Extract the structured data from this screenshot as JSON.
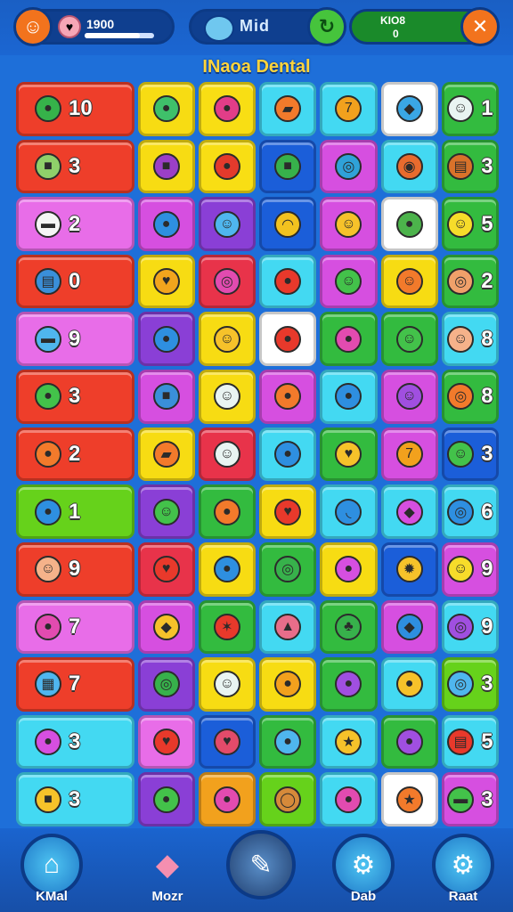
{
  "header": {
    "score": "1900",
    "player_name": "Mid",
    "coins_label": "KIO8",
    "coins_value": "0",
    "score_progress_pct": 80
  },
  "level_title": "INaoa Dental",
  "board": {
    "rows": 13,
    "cols": 8,
    "tiles": [
      {
        "row": 0,
        "col": 0,
        "span": 2,
        "color": "#ee3e2a",
        "icon": "green-bean-icon",
        "glyph": "●",
        "icon_color": "#36b24a",
        "count": "10"
      },
      {
        "row": 0,
        "col": 2,
        "color": "#f7dc13",
        "icon": "green-blob-icon",
        "glyph": "●",
        "icon_color": "#3fc06a",
        "count": ""
      },
      {
        "row": 0,
        "col": 3,
        "color": "#f8de14",
        "icon": "berry-icon",
        "glyph": "●",
        "icon_color": "#e23d88",
        "count": ""
      },
      {
        "row": 0,
        "col": 4,
        "color": "#43d9f2",
        "icon": "carrot-icon",
        "glyph": "▰",
        "icon_color": "#f27a2b",
        "count": ""
      },
      {
        "row": 0,
        "col": 5,
        "color": "#43d9f2",
        "icon": "seven-icon",
        "glyph": "7",
        "icon_color": "#f2a11d",
        "count": ""
      },
      {
        "row": 0,
        "col": 6,
        "color": "#ffffff",
        "icon": "blue-fish-icon",
        "glyph": "◆",
        "icon_color": "#3aa7e5",
        "count": ""
      },
      {
        "row": 0,
        "col": 7,
        "color": "#33bb3f",
        "icon": "ghost-face-icon",
        "glyph": "☺",
        "icon_color": "#e9f4f2",
        "count": "1"
      },
      {
        "row": 1,
        "col": 0,
        "span": 2,
        "color": "#ee3e2a",
        "icon": "chest-icon",
        "glyph": "■",
        "icon_color": "#8fd06a",
        "count": "3"
      },
      {
        "row": 1,
        "col": 2,
        "color": "#f7dc13",
        "icon": "purple-box-icon",
        "glyph": "■",
        "icon_color": "#9b3fc7",
        "count": ""
      },
      {
        "row": 1,
        "col": 3,
        "color": "#f8de14",
        "icon": "apple-icon",
        "glyph": "●",
        "icon_color": "#e33a2c",
        "count": ""
      },
      {
        "row": 1,
        "col": 4,
        "color": "#1b5ed9",
        "icon": "green-book-icon",
        "glyph": "■",
        "icon_color": "#37b14b",
        "count": ""
      },
      {
        "row": 1,
        "col": 5,
        "color": "#d64fe0",
        "icon": "donut-icon",
        "glyph": "◎",
        "icon_color": "#2fa2d8",
        "count": ""
      },
      {
        "row": 1,
        "col": 6,
        "color": "#43d9f2",
        "icon": "snail-icon",
        "glyph": "◉",
        "icon_color": "#e86b2e",
        "count": ""
      },
      {
        "row": 1,
        "col": 7,
        "color": "#33bb3f",
        "icon": "drum-icon",
        "glyph": "▤",
        "icon_color": "#d9722a",
        "count": "3"
      },
      {
        "row": 2,
        "col": 0,
        "span": 2,
        "color": "#e86de8",
        "icon": "bus-icon",
        "glyph": "▬",
        "icon_color": "#f5f5f5",
        "count": "2"
      },
      {
        "row": 2,
        "col": 2,
        "color": "#d64fe0",
        "icon": "blue-leaf-icon",
        "glyph": "●",
        "icon_color": "#2e8fe0",
        "count": ""
      },
      {
        "row": 2,
        "col": 3,
        "color": "#8a3fd6",
        "icon": "blue-blob-icon",
        "glyph": "☺",
        "icon_color": "#4fb6ee",
        "count": ""
      },
      {
        "row": 2,
        "col": 4,
        "color": "#1b5ed9",
        "icon": "rainbow-icon",
        "glyph": "◠",
        "icon_color": "#f2c21f",
        "count": ""
      },
      {
        "row": 2,
        "col": 5,
        "color": "#d64fe0",
        "icon": "smiley-coin-icon",
        "glyph": "☺",
        "icon_color": "#f6c22a",
        "count": ""
      },
      {
        "row": 2,
        "col": 6,
        "color": "#ffffff",
        "icon": "leaf-icon",
        "glyph": "●",
        "icon_color": "#4cb34b",
        "count": ""
      },
      {
        "row": 2,
        "col": 7,
        "color": "#33bb3f",
        "icon": "yellow-smile-icon",
        "glyph": "☺",
        "icon_color": "#f6dc2a",
        "count": "5"
      },
      {
        "row": 3,
        "col": 0,
        "span": 2,
        "color": "#ee3e2a",
        "icon": "barrel-icon",
        "glyph": "▤",
        "icon_color": "#3a8fd9",
        "count": "0"
      },
      {
        "row": 3,
        "col": 2,
        "color": "#f7dc13",
        "icon": "heart-icon",
        "glyph": "♥",
        "icon_color": "#f2a51d",
        "count": ""
      },
      {
        "row": 3,
        "col": 3,
        "color": "#e8334a",
        "icon": "lollipop-icon",
        "glyph": "◎",
        "icon_color": "#e24bb0",
        "count": ""
      },
      {
        "row": 3,
        "col": 4,
        "color": "#43d9f2",
        "icon": "tomato-icon",
        "glyph": "●",
        "icon_color": "#e8392b",
        "count": ""
      },
      {
        "row": 3,
        "col": 5,
        "color": "#d64fe0",
        "icon": "green-ball-icon",
        "glyph": "☺",
        "icon_color": "#43c24a",
        "count": ""
      },
      {
        "row": 3,
        "col": 6,
        "color": "#f7dc13",
        "icon": "orange-face-icon",
        "glyph": "☺",
        "icon_color": "#f27a2b",
        "count": ""
      },
      {
        "row": 3,
        "col": 7,
        "color": "#33bb3f",
        "icon": "magnifier-icon",
        "glyph": "◎",
        "icon_color": "#f0a06a",
        "count": "2"
      },
      {
        "row": 4,
        "col": 0,
        "span": 2,
        "color": "#e86de8",
        "icon": "pot-icon",
        "glyph": "▬",
        "icon_color": "#4fb6ee",
        "count": "9"
      },
      {
        "row": 4,
        "col": 2,
        "color": "#8a3fd6",
        "icon": "bird-icon",
        "glyph": "●",
        "icon_color": "#2e8fe0",
        "count": ""
      },
      {
        "row": 4,
        "col": 3,
        "color": "#f7dc13",
        "icon": "cookie-face-icon",
        "glyph": "☺",
        "icon_color": "#f6c22a",
        "count": ""
      },
      {
        "row": 4,
        "col": 4,
        "color": "#ffffff",
        "icon": "red-apple-icon",
        "glyph": "●",
        "icon_color": "#e8392b",
        "count": ""
      },
      {
        "row": 4,
        "col": 5,
        "color": "#33bb3f",
        "icon": "plum-icon",
        "glyph": "●",
        "icon_color": "#e24bb0",
        "count": ""
      },
      {
        "row": 4,
        "col": 6,
        "color": "#33bb3f",
        "icon": "frog-face-icon",
        "glyph": "☺",
        "icon_color": "#43c24a",
        "count": ""
      },
      {
        "row": 4,
        "col": 7,
        "color": "#43d9f2",
        "icon": "peach-face-icon",
        "glyph": "☺",
        "icon_color": "#f5b28a",
        "count": "8"
      },
      {
        "row": 5,
        "col": 0,
        "span": 2,
        "color": "#ee3e2a",
        "icon": "snake-icon",
        "glyph": "●",
        "icon_color": "#43c24a",
        "count": "3"
      },
      {
        "row": 5,
        "col": 2,
        "color": "#d64fe0",
        "icon": "notebook-icon",
        "glyph": "■",
        "icon_color": "#3a8fd9",
        "count": ""
      },
      {
        "row": 5,
        "col": 3,
        "color": "#f7dc13",
        "icon": "cloud-face-icon",
        "glyph": "☺",
        "icon_color": "#e9f4f2",
        "count": ""
      },
      {
        "row": 5,
        "col": 4,
        "color": "#d64fe0",
        "icon": "map-pin-icon",
        "glyph": "●",
        "icon_color": "#f27a2b",
        "count": ""
      },
      {
        "row": 5,
        "col": 5,
        "color": "#43d9f2",
        "icon": "blue-bell-icon",
        "glyph": "●",
        "icon_color": "#2e8fe0",
        "count": ""
      },
      {
        "row": 5,
        "col": 6,
        "color": "#d64fe0",
        "icon": "purple-monster-icon",
        "glyph": "☺",
        "icon_color": "#a04fe0",
        "count": ""
      },
      {
        "row": 5,
        "col": 7,
        "color": "#33bb3f",
        "icon": "spiral-icon",
        "glyph": "◎",
        "icon_color": "#f27a2b",
        "count": "8"
      },
      {
        "row": 6,
        "col": 0,
        "span": 2,
        "color": "#ee3e2a",
        "icon": "mushroom-icon",
        "glyph": "●",
        "icon_color": "#f27a2b",
        "count": "2"
      },
      {
        "row": 6,
        "col": 2,
        "color": "#f7dc13",
        "icon": "orange-stick-icon",
        "glyph": "▰",
        "icon_color": "#f27a2b",
        "count": ""
      },
      {
        "row": 6,
        "col": 3,
        "color": "#e8334a",
        "icon": "star-ghost-icon",
        "glyph": "☺",
        "icon_color": "#e9f4f2",
        "count": ""
      },
      {
        "row": 6,
        "col": 4,
        "color": "#43d9f2",
        "icon": "chat-bubble-icon",
        "glyph": "●",
        "icon_color": "#2e8fe0",
        "count": ""
      },
      {
        "row": 6,
        "col": 5,
        "color": "#33bb3f",
        "icon": "yellow-heart-icon",
        "glyph": "♥",
        "icon_color": "#f6c22a",
        "count": ""
      },
      {
        "row": 6,
        "col": 6,
        "color": "#d64fe0",
        "icon": "orange-seven-icon",
        "glyph": "7",
        "icon_color": "#f2a11d",
        "count": ""
      },
      {
        "row": 6,
        "col": 7,
        "color": "#1b5ed9",
        "icon": "green-blob-face-icon",
        "glyph": "☺",
        "icon_color": "#43c24a",
        "count": "3"
      },
      {
        "row": 7,
        "col": 0,
        "span": 2,
        "color": "#66d21b",
        "icon": "fish-tail-icon",
        "glyph": "●",
        "icon_color": "#2e8fe0",
        "count": "1"
      },
      {
        "row": 7,
        "col": 2,
        "color": "#8a3fd6",
        "icon": "green-monster-icon",
        "glyph": "☺",
        "icon_color": "#43c24a",
        "count": ""
      },
      {
        "row": 7,
        "col": 3,
        "color": "#33bb3f",
        "icon": "carrot-face-icon",
        "glyph": "●",
        "icon_color": "#f27a2b",
        "count": ""
      },
      {
        "row": 7,
        "col": 4,
        "color": "#f7dc13",
        "icon": "red-heart-icon",
        "glyph": "♥",
        "icon_color": "#e8392b",
        "count": ""
      },
      {
        "row": 7,
        "col": 5,
        "color": "#43d9f2",
        "icon": "banana-icon",
        "glyph": "◟",
        "icon_color": "#2e8fe0",
        "count": ""
      },
      {
        "row": 7,
        "col": 6,
        "color": "#43d9f2",
        "icon": "magenta-flag-icon",
        "glyph": "◆",
        "icon_color": "#d64fe0",
        "count": ""
      },
      {
        "row": 7,
        "col": 7,
        "color": "#43d9f2",
        "icon": "clock-icon",
        "glyph": "◎",
        "icon_color": "#2e8fe0",
        "count": "6"
      },
      {
        "row": 8,
        "col": 0,
        "span": 2,
        "color": "#ee3e2a",
        "icon": "baby-face-icon",
        "glyph": "☺",
        "icon_color": "#f5b28a",
        "count": "9"
      },
      {
        "row": 8,
        "col": 2,
        "color": "#e8334a",
        "icon": "apple-heart-icon",
        "glyph": "♥",
        "icon_color": "#e8392b",
        "count": ""
      },
      {
        "row": 8,
        "col": 3,
        "color": "#f7dc13",
        "icon": "blue-bomb-icon",
        "glyph": "●",
        "icon_color": "#2e8fe0",
        "count": ""
      },
      {
        "row": 8,
        "col": 4,
        "color": "#33bb3f",
        "icon": "square-spiral-icon",
        "glyph": "◎",
        "icon_color": "#37b14b",
        "count": ""
      },
      {
        "row": 8,
        "col": 5,
        "color": "#f7dc13",
        "icon": "purple-dome-icon",
        "glyph": "●",
        "icon_color": "#d64fe0",
        "count": ""
      },
      {
        "row": 8,
        "col": 6,
        "color": "#1b5ed9",
        "icon": "sun-icon",
        "glyph": "✹",
        "icon_color": "#f6c22a",
        "count": ""
      },
      {
        "row": 8,
        "col": 7,
        "color": "#d64fe0",
        "icon": "sun-face-icon",
        "glyph": "☺",
        "icon_color": "#f6dc2a",
        "count": "9"
      },
      {
        "row": 9,
        "col": 0,
        "span": 2,
        "color": "#e86de8",
        "icon": "lips-icon",
        "glyph": "●",
        "icon_color": "#e24bb0",
        "count": "7"
      },
      {
        "row": 9,
        "col": 2,
        "color": "#d64fe0",
        "icon": "cheese-icon",
        "glyph": "◆",
        "icon_color": "#f6c22a",
        "count": ""
      },
      {
        "row": 9,
        "col": 3,
        "color": "#33bb3f",
        "icon": "red-star-icon",
        "glyph": "✶",
        "icon_color": "#e8392b",
        "count": ""
      },
      {
        "row": 9,
        "col": 4,
        "color": "#43d9f2",
        "icon": "cupcake-icon",
        "glyph": "▲",
        "icon_color": "#e86d8a",
        "count": ""
      },
      {
        "row": 9,
        "col": 5,
        "color": "#33bb3f",
        "icon": "clover-icon",
        "glyph": "♣",
        "icon_color": "#37b14b",
        "count": ""
      },
      {
        "row": 9,
        "col": 6,
        "color": "#d64fe0",
        "icon": "gem-icon",
        "glyph": "◆",
        "icon_color": "#2e8fe0",
        "count": ""
      },
      {
        "row": 9,
        "col": 7,
        "color": "#43d9f2",
        "icon": "purple-donut-icon",
        "glyph": "◎",
        "icon_color": "#a04fe0",
        "count": "9"
      },
      {
        "row": 10,
        "col": 0,
        "span": 2,
        "color": "#ee3e2a",
        "icon": "window-icon",
        "glyph": "▦",
        "icon_color": "#4fb6ee",
        "count": "7"
      },
      {
        "row": 10,
        "col": 2,
        "color": "#8a3fd6",
        "icon": "green-swirl-icon",
        "glyph": "◎",
        "icon_color": "#37b14b",
        "count": ""
      },
      {
        "row": 10,
        "col": 3,
        "color": "#f7dc13",
        "icon": "white-cat-icon",
        "glyph": "☺",
        "icon_color": "#e9f4f2",
        "count": ""
      },
      {
        "row": 10,
        "col": 4,
        "color": "#f7dc13",
        "icon": "orange-egg-icon",
        "glyph": "●",
        "icon_color": "#f2a11d",
        "count": ""
      },
      {
        "row": 10,
        "col": 5,
        "color": "#33bb3f",
        "icon": "purple-shell-icon",
        "glyph": "●",
        "icon_color": "#a04fe0",
        "count": ""
      },
      {
        "row": 10,
        "col": 6,
        "color": "#43d9f2",
        "icon": "yellow-bird-icon",
        "glyph": "●",
        "icon_color": "#f6c22a",
        "count": ""
      },
      {
        "row": 10,
        "col": 7,
        "color": "#66d21b",
        "icon": "blue-ring-icon",
        "glyph": "◎",
        "icon_color": "#4fb6ee",
        "count": "3"
      },
      {
        "row": 11,
        "col": 0,
        "span": 2,
        "color": "#43d9f2",
        "icon": "purple-plum-icon",
        "glyph": "●",
        "icon_color": "#d64fe0",
        "count": "3"
      },
      {
        "row": 11,
        "col": 2,
        "color": "#e86de8",
        "icon": "big-heart-icon",
        "glyph": "♥",
        "icon_color": "#e8392b",
        "count": ""
      },
      {
        "row": 11,
        "col": 3,
        "color": "#1b5ed9",
        "icon": "cherry-heart-icon",
        "glyph": "♥",
        "icon_color": "#e24b6a",
        "count": ""
      },
      {
        "row": 11,
        "col": 4,
        "color": "#33bb3f",
        "icon": "blue-drop-icon",
        "glyph": "●",
        "icon_color": "#4fb6ee",
        "count": ""
      },
      {
        "row": 11,
        "col": 5,
        "color": "#43d9f2",
        "icon": "gold-star-icon",
        "glyph": "★",
        "icon_color": "#f6c22a",
        "count": ""
      },
      {
        "row": 11,
        "col": 6,
        "color": "#33bb3f",
        "icon": "purple-eye-icon",
        "glyph": "●",
        "icon_color": "#a04fe0",
        "count": ""
      },
      {
        "row": 11,
        "col": 7,
        "color": "#43d9f2",
        "icon": "cake-icon",
        "glyph": "▤",
        "icon_color": "#e8392b",
        "count": "5"
      },
      {
        "row": 12,
        "col": 0,
        "span": 2,
        "color": "#43d9f2",
        "icon": "jar-icon",
        "glyph": "■",
        "icon_color": "#f6c22a",
        "count": "3"
      },
      {
        "row": 12,
        "col": 2,
        "color": "#8a3fd6",
        "icon": "green-pepper-icon",
        "glyph": "●",
        "icon_color": "#43c24a",
        "count": ""
      },
      {
        "row": 12,
        "col": 3,
        "color": "#f2a11d",
        "icon": "pink-plum-icon",
        "glyph": "●",
        "icon_color": "#e24bb0",
        "count": ""
      },
      {
        "row": 12,
        "col": 4,
        "color": "#66d21b",
        "icon": "ring-icon",
        "glyph": "◯",
        "icon_color": "#d68a3a",
        "count": ""
      },
      {
        "row": 12,
        "col": 5,
        "color": "#43d9f2",
        "icon": "pink-apple-icon",
        "glyph": "●",
        "icon_color": "#e24bb0",
        "count": ""
      },
      {
        "row": 12,
        "col": 6,
        "color": "#ffffff",
        "icon": "orange-star-icon",
        "glyph": "★",
        "icon_color": "#f27a2b",
        "count": ""
      },
      {
        "row": 12,
        "col": 7,
        "color": "#d64fe0",
        "icon": "salad-bowl-icon",
        "glyph": "▬",
        "icon_color": "#43c24a",
        "count": "3"
      }
    ]
  },
  "bottom_nav": [
    {
      "label": "KMal",
      "icon": "home-icon",
      "glyph": "⌂",
      "name": "nav-home"
    },
    {
      "label": "Mozr",
      "icon": "eraser-icon",
      "glyph": "◆",
      "name": "nav-eraser"
    },
    {
      "label": "",
      "icon": "pencil-icon",
      "glyph": "✎",
      "name": "nav-pencil"
    },
    {
      "label": "Dab",
      "icon": "gear-icon",
      "glyph": "⚙",
      "name": "nav-gear"
    },
    {
      "label": "Raat",
      "icon": "settings-icon",
      "glyph": "⚙",
      "name": "nav-settings"
    }
  ]
}
